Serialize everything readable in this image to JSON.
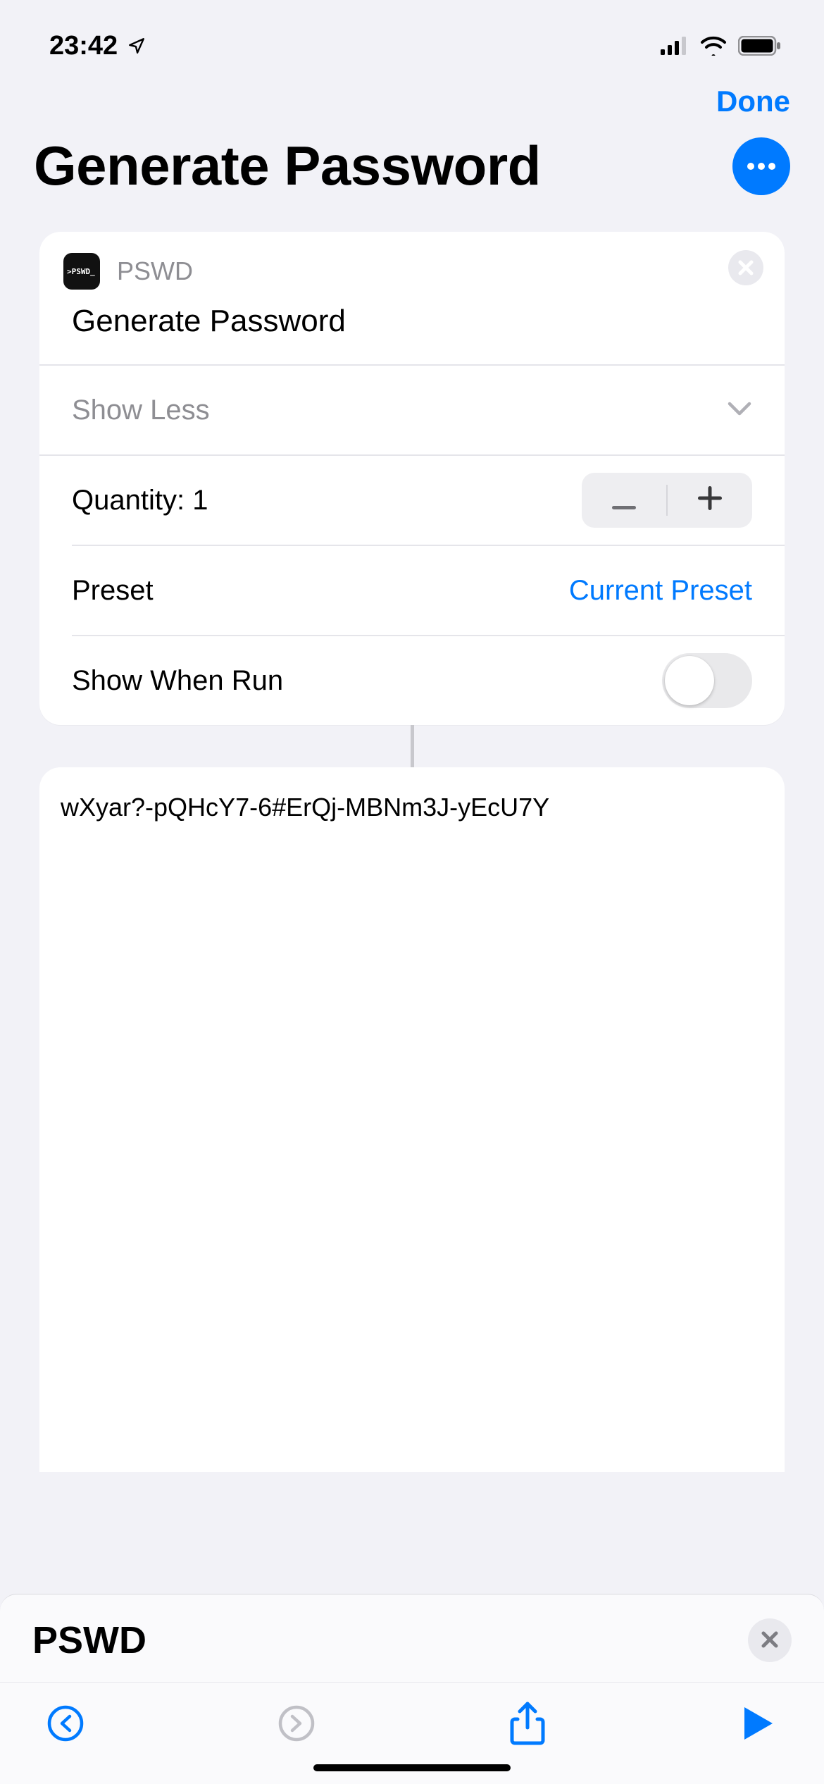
{
  "status": {
    "time": "23:42"
  },
  "header": {
    "done_label": "Done",
    "title": "Generate Password"
  },
  "action": {
    "app_icon_text": ">PSWD_",
    "app_name": "PSWD",
    "title": "Generate Password",
    "show_less_label": "Show Less",
    "quantity_label": "Quantity: 1",
    "preset_label": "Preset",
    "preset_value": "Current Preset",
    "show_when_run_label": "Show When Run",
    "show_when_run_on": false
  },
  "output": {
    "text": "wXyar?-pQHcY7-6#ErQj-MBNm3J-yEcU7Y"
  },
  "sheet": {
    "title": "PSWD"
  },
  "colors": {
    "accent": "#007aff"
  }
}
